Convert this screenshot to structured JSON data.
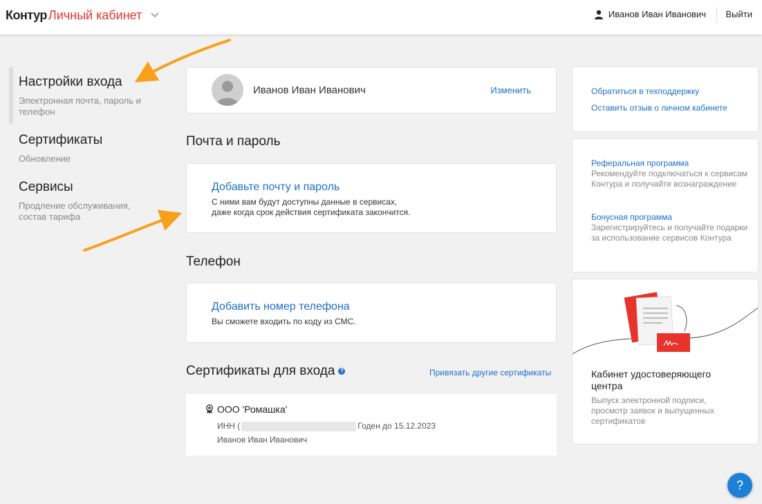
{
  "header": {
    "brand": "Контур",
    "product": "Личный кабинет",
    "user_name": "Иванов Иван Иванович",
    "logout": "Выйти"
  },
  "sidebar": {
    "items": [
      {
        "title": "Настройки входа",
        "subtitle": "Электронная почта, пароль и телефон",
        "active": true
      },
      {
        "title": "Сертификаты",
        "subtitle": "Обновление",
        "active": false
      },
      {
        "title": "Сервисы",
        "subtitle": "Продление обслуживания, состав тарифа",
        "active": false
      }
    ]
  },
  "profile": {
    "name": "Иванов Иван Иванович",
    "edit_label": "Изменить"
  },
  "email_section": {
    "title": "Почта и пароль",
    "cta": "Добавьте почту и пароль",
    "desc_line1": "С ними вам будут доступны данные в сервисах,",
    "desc_line2": "даже когда срок действия сертификата закончится."
  },
  "phone_section": {
    "title": "Телефон",
    "cta": "Добавить номер телефона",
    "desc": "Вы сможете входить по коду из СМС."
  },
  "certs_section": {
    "title": "Сертификаты для входа",
    "help_icon": "?",
    "link": "Привязать другие сертификаты",
    "cert": {
      "org": "ООО 'Ромашка'",
      "inn_prefix": "ИНН (",
      "valid_until": "Годен до 15.12.2023",
      "owner": "Иванов Иван Иванович"
    }
  },
  "right": {
    "support": "Обратиться в техподдержку",
    "feedback": "Оставить отзыв о личном кабинете",
    "referral_title": "Реферальная программа",
    "referral_desc": "Рекомендуйте подключаться к сервисам Контура и получайте вознаграждение",
    "bonus_title": "Бонусная программа",
    "bonus_desc": "Зарегистрируйтесь и получайте подарки за использование сервисов Контура",
    "ca_title": "Кабинет удостоверяющего центра",
    "ca_desc": "Выпуск электронной подписи, просмотр заявок и выпущенных сертификатов"
  },
  "help_fab": "?",
  "colors": {
    "link": "#1e6ec8",
    "brand_red": "#e8332d",
    "annotation_arrow": "#f7a01c"
  }
}
